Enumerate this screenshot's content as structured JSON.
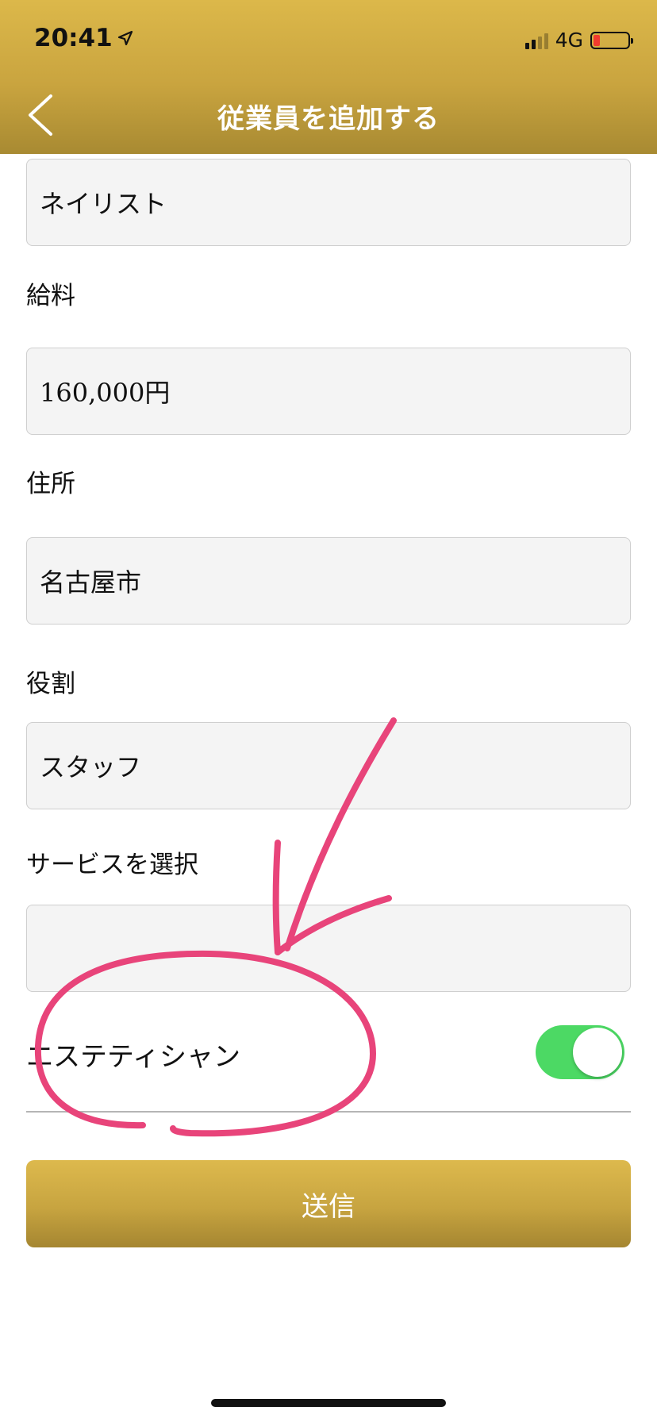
{
  "status_bar": {
    "time": "20:41",
    "network": "4G"
  },
  "nav": {
    "title": "従業員を追加する",
    "back_icon": "chevron-left-icon"
  },
  "form": {
    "job_title_value": "ネイリスト",
    "salary_label": "給料",
    "salary_value": "160,000円",
    "address_label": "住所",
    "address_value": "名古屋市",
    "role_label": "役割",
    "role_value": "スタッフ",
    "service_label": "サービスを選択",
    "service_value": "",
    "service_option": {
      "label": "エステティシャン",
      "enabled": true
    }
  },
  "submit_label": "送信",
  "colors": {
    "header_gold": "#c9a43f",
    "toggle_on": "#4cd964",
    "annotation_pink": "#e8447a",
    "battery_low": "#f23b2f"
  }
}
